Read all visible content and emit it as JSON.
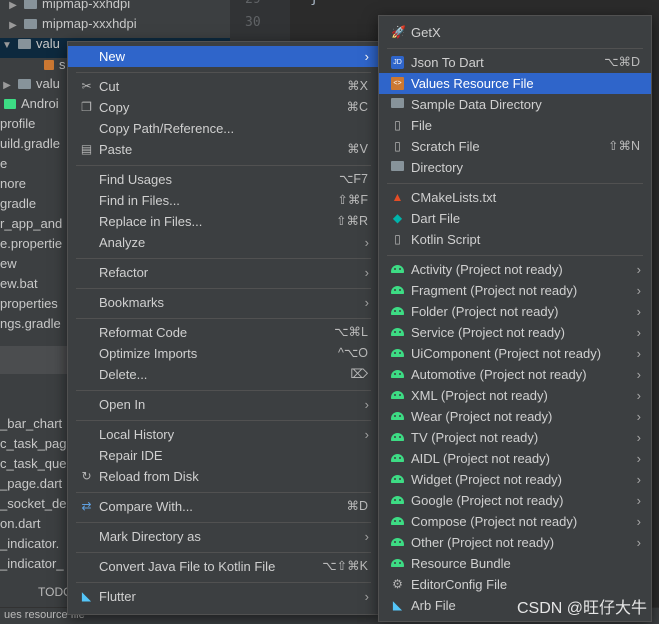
{
  "editor": {
    "line_numbers": [
      "29",
      "30"
    ],
    "brace": "}"
  },
  "tree": {
    "rows": [
      "mipmap-xxhdpi",
      "mipmap-xxxhdpi",
      "valu",
      "s",
      "valu",
      "Androi",
      "profile",
      "uild.gradle",
      "e",
      "nore",
      "gradle",
      "r_app_and",
      "e.propertie",
      "ew",
      "ew.bat",
      "properties",
      "ngs.gradle",
      "_bar_chart",
      "c_task_pag",
      "c_task_que",
      "_page.dart",
      "_socket_de",
      "on.dart",
      "_indicator.",
      "_indicator_"
    ]
  },
  "status_bar": {
    "text": "ues resource file",
    "todo": "TODO"
  },
  "context_menu": {
    "items": [
      {
        "label": "New",
        "arrow": true
      },
      {
        "label": "Cut",
        "shortcut": "⌘X",
        "icon": "scissors-icon"
      },
      {
        "label": "Copy",
        "shortcut": "⌘C",
        "icon": "copy-icon"
      },
      {
        "label": "Copy Path/Reference..."
      },
      {
        "label": "Paste",
        "shortcut": "⌘V",
        "icon": "paste-icon"
      },
      {
        "label": "Find Usages",
        "shortcut": "⌥F7"
      },
      {
        "label": "Find in Files...",
        "shortcut": "⇧⌘F"
      },
      {
        "label": "Replace in Files...",
        "shortcut": "⇧⌘R"
      },
      {
        "label": "Analyze",
        "arrow": true
      },
      {
        "label": "Refactor",
        "arrow": true
      },
      {
        "label": "Bookmarks",
        "arrow": true
      },
      {
        "label": "Reformat Code",
        "shortcut": "⌥⌘L"
      },
      {
        "label": "Optimize Imports",
        "shortcut": "^⌥O"
      },
      {
        "label": "Delete...",
        "shortcut": "⌦"
      },
      {
        "label": "Open In",
        "arrow": true
      },
      {
        "label": "Local History",
        "arrow": true
      },
      {
        "label": "Repair IDE"
      },
      {
        "label": "Reload from Disk",
        "icon": "reload-icon"
      },
      {
        "label": "Compare With...",
        "shortcut": "⌘D",
        "icon": "compare-icon"
      },
      {
        "label": "Mark Directory as",
        "arrow": true
      },
      {
        "label": "Convert Java File to Kotlin File",
        "shortcut": "⌥⇧⌘K"
      },
      {
        "label": "Flutter",
        "arrow": true,
        "icon": "flutter-icon"
      }
    ]
  },
  "new_submenu": {
    "items": [
      {
        "label": "GetX",
        "icon": "getx-icon"
      },
      {
        "label": "Json To Dart",
        "shortcut": "⌥⌘D",
        "icon": "json-icon"
      },
      {
        "label": "Values Resource File",
        "icon": "values-file-icon"
      },
      {
        "label": "Sample Data Directory",
        "icon": "folder-icon"
      },
      {
        "label": "File",
        "icon": "file-icon"
      },
      {
        "label": "Scratch File",
        "shortcut": "⇧⌘N",
        "icon": "scratch-icon"
      },
      {
        "label": "Directory",
        "icon": "folder-icon"
      },
      {
        "label": "CMakeLists.txt",
        "icon": "cmake-icon"
      },
      {
        "label": "Dart File",
        "icon": "dart-icon"
      },
      {
        "label": "Kotlin Script",
        "icon": "kotlin-icon"
      },
      {
        "label": "Activity (Project not ready)",
        "arrow": true
      },
      {
        "label": "Fragment (Project not ready)",
        "arrow": true
      },
      {
        "label": "Folder (Project not ready)",
        "arrow": true
      },
      {
        "label": "Service (Project not ready)",
        "arrow": true
      },
      {
        "label": "UiComponent (Project not ready)",
        "arrow": true
      },
      {
        "label": "Automotive (Project not ready)",
        "arrow": true
      },
      {
        "label": "XML (Project not ready)",
        "arrow": true
      },
      {
        "label": "Wear (Project not ready)",
        "arrow": true
      },
      {
        "label": "TV (Project not ready)",
        "arrow": true
      },
      {
        "label": "AIDL (Project not ready)",
        "arrow": true
      },
      {
        "label": "Widget (Project not ready)",
        "arrow": true
      },
      {
        "label": "Google (Project not ready)",
        "arrow": true
      },
      {
        "label": "Compose (Project not ready)",
        "arrow": true
      },
      {
        "label": "Other (Project not ready)",
        "arrow": true
      },
      {
        "label": "Resource Bundle",
        "icon": "android-icon"
      },
      {
        "label": "EditorConfig File",
        "icon": "gear-icon"
      },
      {
        "label": "Arb File",
        "icon": "arb-icon"
      }
    ]
  },
  "watermark": "CSDN @旺仔大牛",
  "colors": {
    "highlight": "#2f65ca",
    "menu_bg": "#3c3f41",
    "android": "#3ddc84"
  }
}
